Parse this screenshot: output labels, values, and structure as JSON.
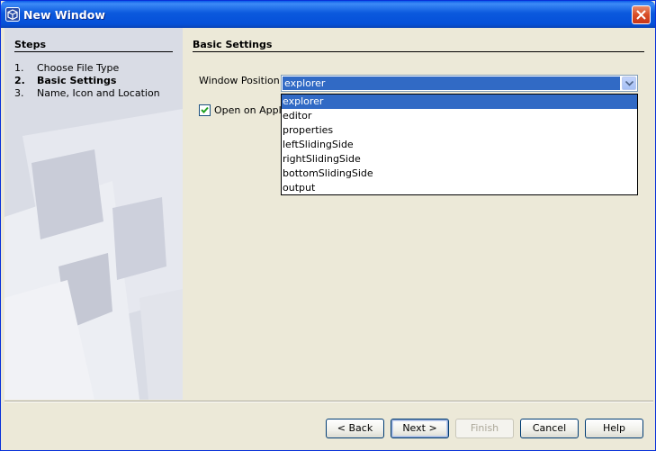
{
  "window": {
    "title": "New Window",
    "app_icon": "netbeans-cube-icon",
    "close_icon": "close-icon"
  },
  "steps": {
    "title": "Steps",
    "items": [
      {
        "num": "1.",
        "label": "Choose File Type"
      },
      {
        "num": "2.",
        "label": "Basic Settings"
      },
      {
        "num": "3.",
        "label": "Name, Icon and Location"
      }
    ]
  },
  "panel": {
    "title": "Basic Settings",
    "window_position_label": "Window Position :",
    "window_position_value": "explorer",
    "options": [
      "explorer",
      "editor",
      "properties",
      "leftSlidingSide",
      "rightSlidingSide",
      "bottomSlidingSide",
      "output"
    ],
    "open_on_startup_label": "Open on Applica"
  },
  "buttons": {
    "back": "< Back",
    "next": "Next >",
    "finish": "Finish",
    "cancel": "Cancel",
    "help": "Help"
  },
  "colors": {
    "titlebar": "#0550d9",
    "selection": "#316ac5",
    "dialog_bg": "#ece9d8",
    "left_pane": "#dadde6"
  }
}
